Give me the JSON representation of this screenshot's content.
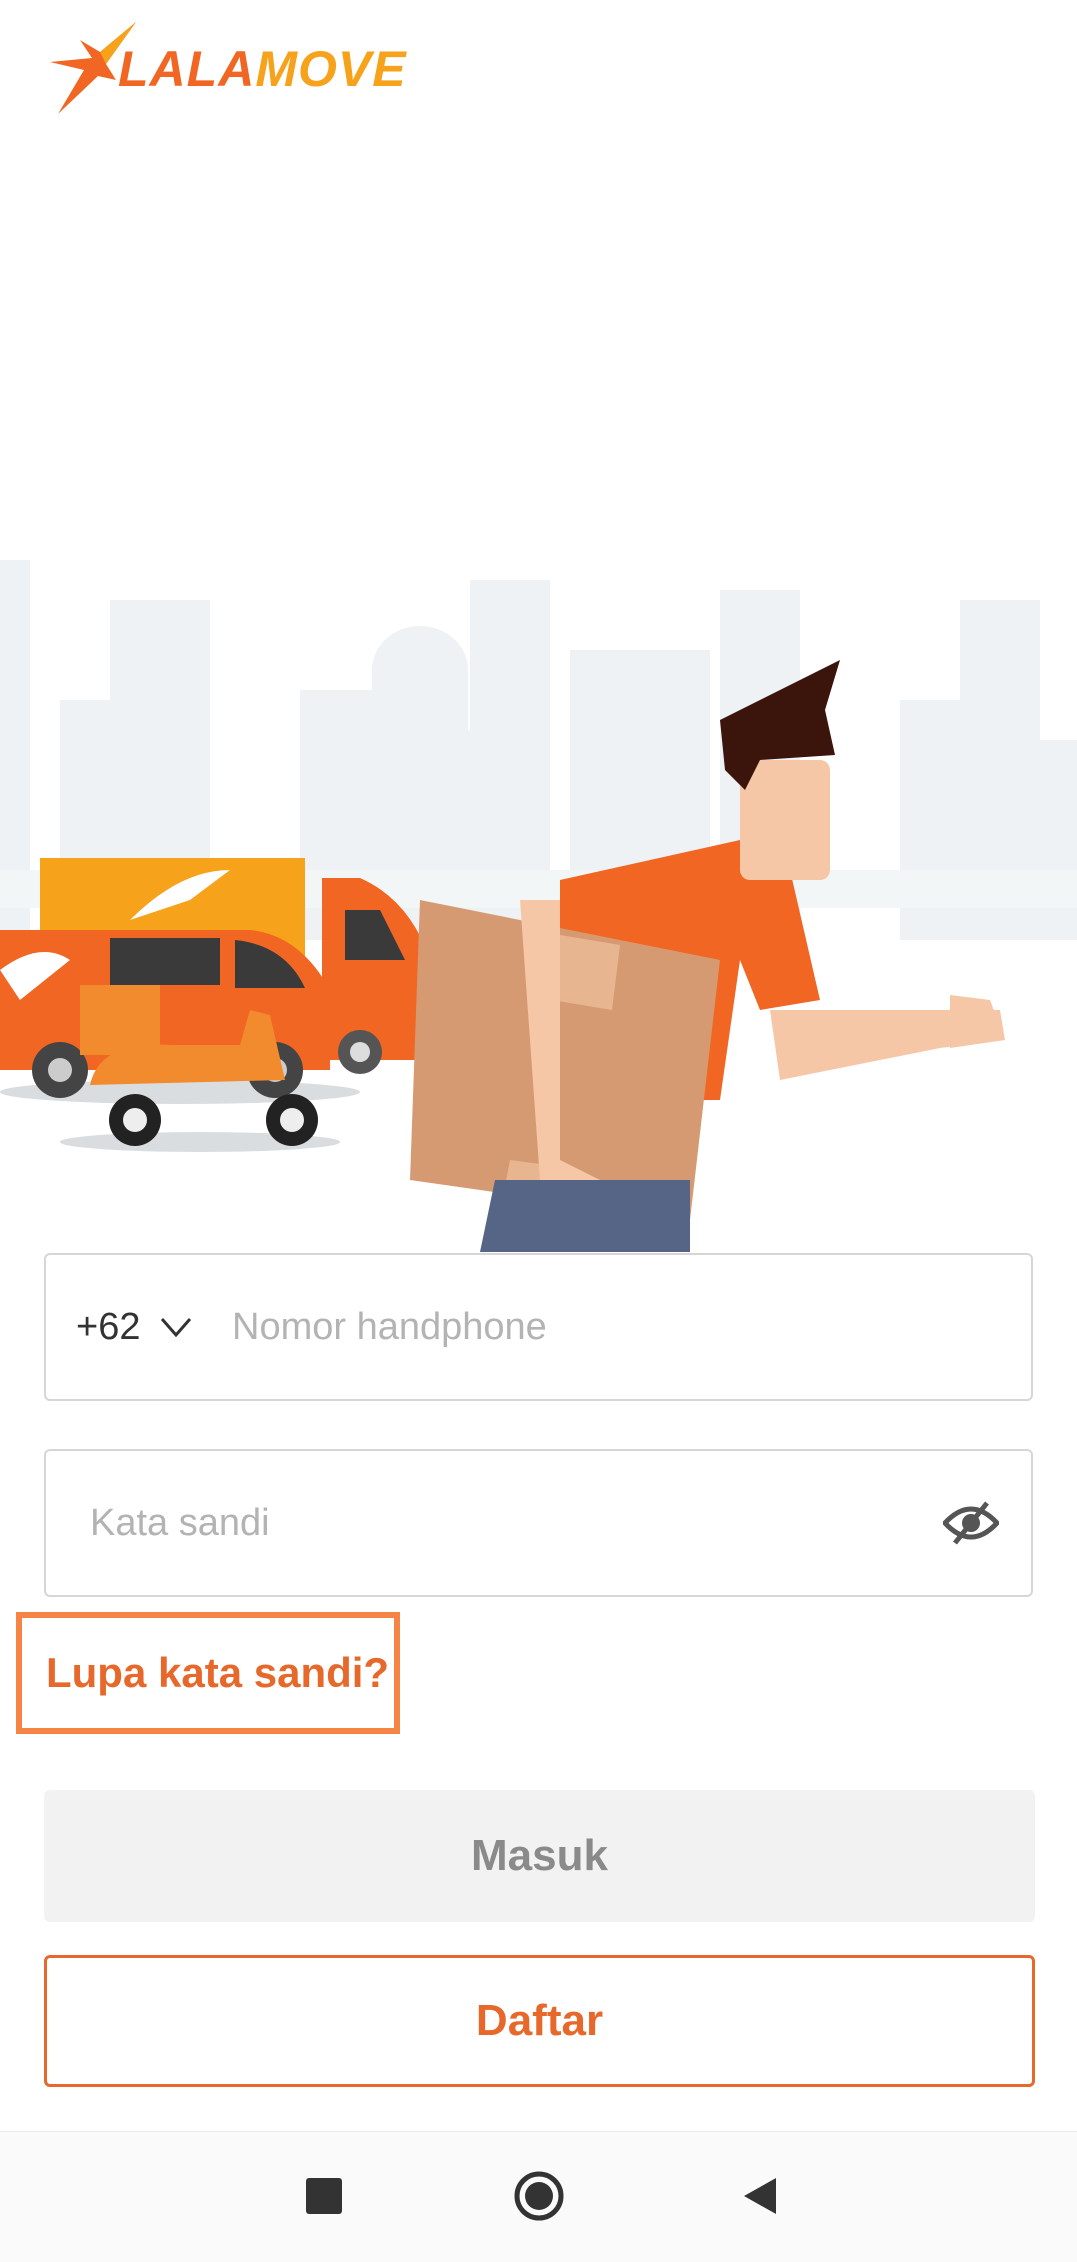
{
  "app": {
    "logo_part1": "LALA",
    "logo_part2": "MOVE"
  },
  "form": {
    "country_code": "+62",
    "phone_placeholder": "Nomor handphone",
    "password_placeholder": "Kata sandi"
  },
  "links": {
    "forgot_password": "Lupa kata sandi?"
  },
  "buttons": {
    "login": "Masuk",
    "register": "Daftar"
  },
  "colors": {
    "brand_orange": "#f16622",
    "brand_yellow": "#f7a21b",
    "highlight_border": "#f58445"
  },
  "icons": {
    "country_dropdown": "chevron-down-icon",
    "password_toggle": "eye-slash-icon",
    "nav_recent": "square-icon",
    "nav_home": "circle-icon",
    "nav_back": "triangle-back-icon"
  }
}
